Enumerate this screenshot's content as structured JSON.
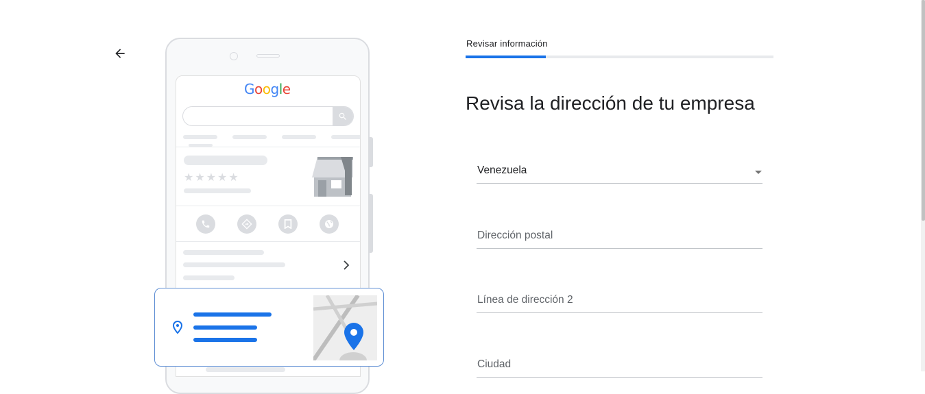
{
  "header": {
    "step_label": "Revisar información",
    "progress_fraction": 0.26
  },
  "form": {
    "title": "Revisa la dirección de tu empresa",
    "country": "Venezuela",
    "postal_address_placeholder": "Dirección postal",
    "address_line2_placeholder": "Línea de dirección 2",
    "city_placeholder": "Ciudad"
  },
  "illustration": {
    "logo": [
      "G",
      "o",
      "o",
      "g",
      "l",
      "e"
    ],
    "logo_colors": [
      "#4285f4",
      "#ea4335",
      "#fbbc05",
      "#4285f4",
      "#34a853",
      "#ea4335"
    ],
    "stars": "★★★★★"
  },
  "icons": {
    "back": "arrow-left-icon",
    "search": "search-icon",
    "phone": "phone-icon",
    "directions": "directions-icon",
    "save": "bookmark-icon",
    "website": "globe-icon",
    "chevron": "chevron-right-icon",
    "location": "location-pin-icon",
    "map_pin": "map-pin-icon",
    "store": "storefront-icon"
  },
  "colors": {
    "accent": "#1a73e8",
    "text": "#202124",
    "placeholder": "#5f6368"
  }
}
